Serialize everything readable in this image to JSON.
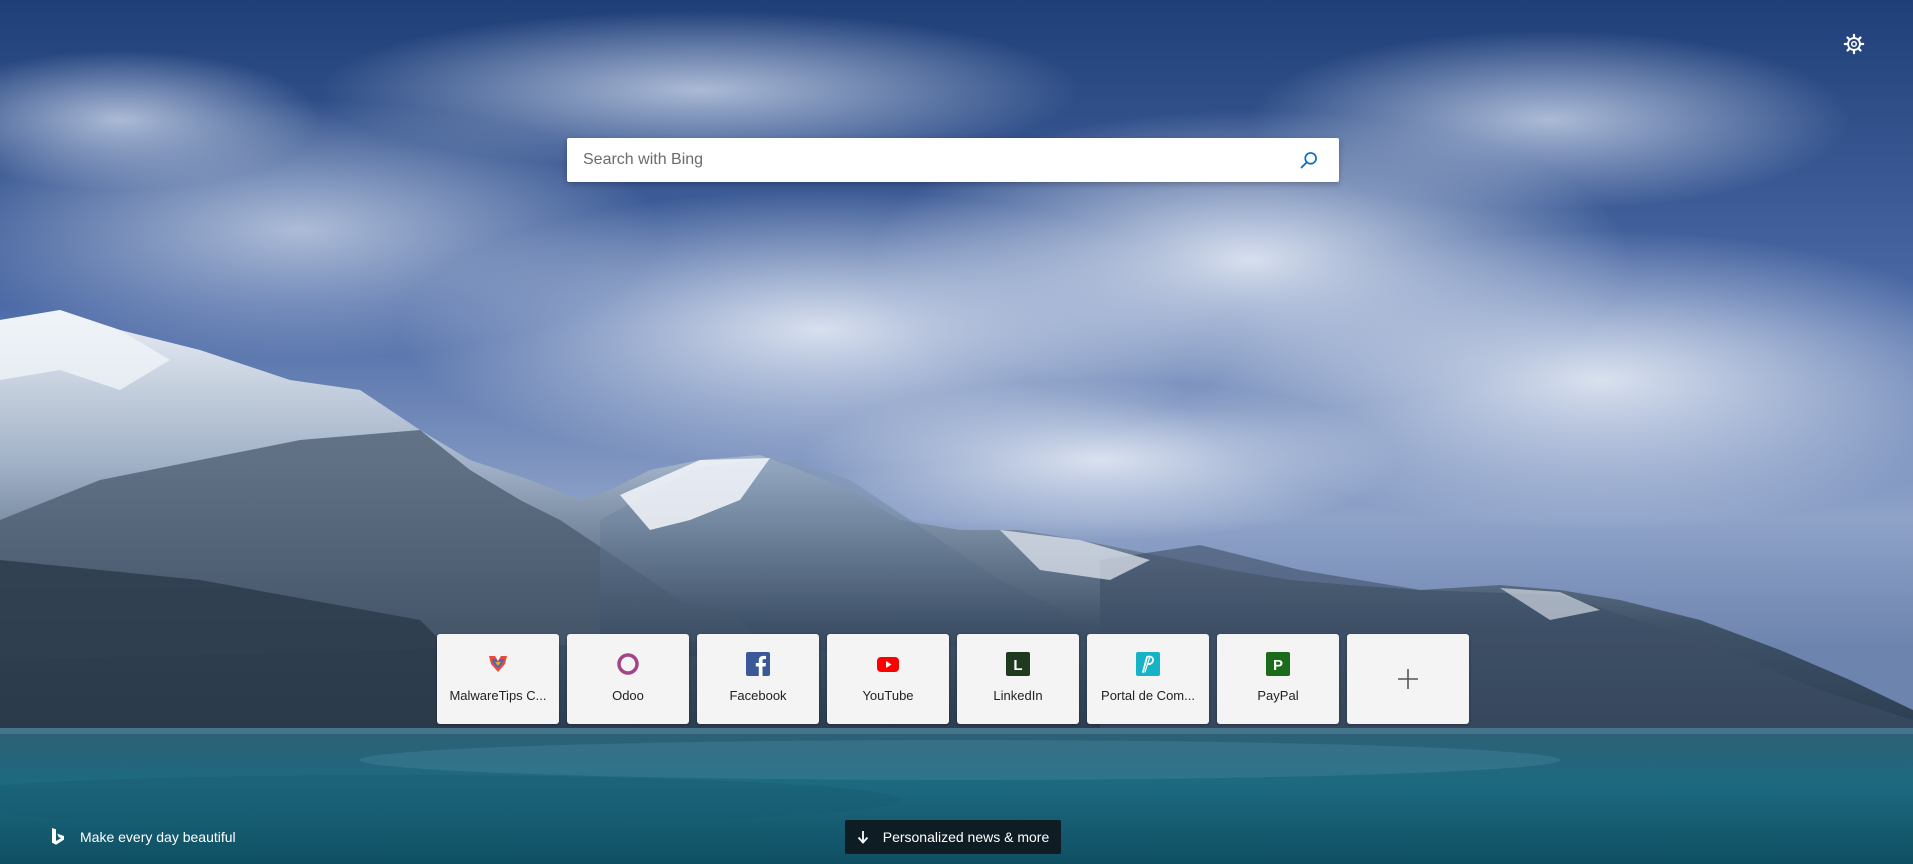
{
  "search": {
    "placeholder": "Search with Bing"
  },
  "quick_links": [
    {
      "label": "MalwareTips C...",
      "icon": "malwaretips-icon"
    },
    {
      "label": "Odoo",
      "icon": "odoo-icon"
    },
    {
      "label": "Facebook",
      "icon": "facebook-icon"
    },
    {
      "label": "YouTube",
      "icon": "youtube-icon"
    },
    {
      "label": "LinkedIn",
      "icon": "linkedin-icon"
    },
    {
      "label": "Portal de Com...",
      "icon": "portal-icon"
    },
    {
      "label": "PayPal",
      "icon": "paypal-icon"
    }
  ],
  "footer": {
    "tagline": "Make every day beautiful",
    "news_button": "Personalized news & more"
  },
  "icons": {
    "settings": "gear-icon",
    "search": "search-icon",
    "add": "plus-icon",
    "bing": "bing-logo-icon",
    "arrow": "arrow-down-icon"
  },
  "colors": {
    "accent": "#0a6ec4",
    "news_bg": "#0e1d24"
  }
}
